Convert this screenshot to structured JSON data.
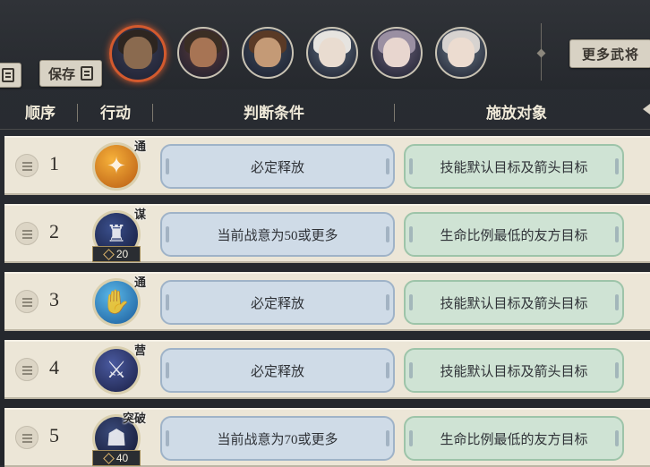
{
  "toolbar": {
    "save_label": "保存",
    "more_generals_label": "更多武将"
  },
  "portraits": [
    {
      "name": "portrait-1",
      "selected": true,
      "skin": "#8a6a4f",
      "hair": "#2d2520",
      "bg": "#3a3d55"
    },
    {
      "name": "portrait-2",
      "selected": false,
      "skin": "#a77454",
      "hair": "#3b2e24",
      "bg": "#5b3a3a"
    },
    {
      "name": "portrait-3",
      "selected": false,
      "skin": "#c49a76",
      "hair": "#5a3a26",
      "bg": "#3c4a5a"
    },
    {
      "name": "portrait-4",
      "selected": false,
      "skin": "#e9dcd0",
      "hair": "#e6e4e0",
      "bg": "#5a6a7a"
    },
    {
      "name": "portrait-5",
      "selected": false,
      "skin": "#e8d6cf",
      "hair": "#9a8fa2",
      "bg": "#6a6078"
    },
    {
      "name": "portrait-6",
      "selected": false,
      "skin": "#ecdcd0",
      "hair": "#d7d3d0",
      "bg": "#6a7a86"
    }
  ],
  "header": {
    "order": "顺序",
    "action": "行动",
    "condition": "判断条件",
    "target": "施放对象"
  },
  "rows": [
    {
      "order": "1",
      "tag": "通",
      "cost": "",
      "condition": "必定释放",
      "target": "技能默认目标及箭头目标",
      "icon": "tiger-shield-icon",
      "colorA": "#f6b13a",
      "colorB": "#b85a12",
      "glyph": "✦"
    },
    {
      "order": "2",
      "tag": "谋",
      "cost": "20",
      "condition": "当前战意为50或更多",
      "target": "生命比例最低的友方目标",
      "icon": "fortress-icon",
      "colorA": "#3a4f8c",
      "colorB": "#141a3a",
      "glyph": "♜"
    },
    {
      "order": "3",
      "tag": "通",
      "cost": "",
      "condition": "必定释放",
      "target": "技能默认目标及箭头目标",
      "icon": "hand-icon",
      "colorA": "#5ab8e8",
      "colorB": "#1a5a9a",
      "glyph": "✋"
    },
    {
      "order": "4",
      "tag": "营",
      "cost": "",
      "condition": "必定释放",
      "target": "技能默认目标及箭头目标",
      "icon": "sword-icon",
      "colorA": "#4a5aa0",
      "colorB": "#1a1f44",
      "glyph": "⚔"
    },
    {
      "order": "5",
      "tag": "突破",
      "cost": "40",
      "condition": "当前战意为70或更多",
      "target": "生命比例最低的友方目标",
      "icon": "hooded-figure-icon",
      "colorA": "#3a4a7a",
      "colorB": "#121630",
      "glyph": "☗"
    }
  ]
}
